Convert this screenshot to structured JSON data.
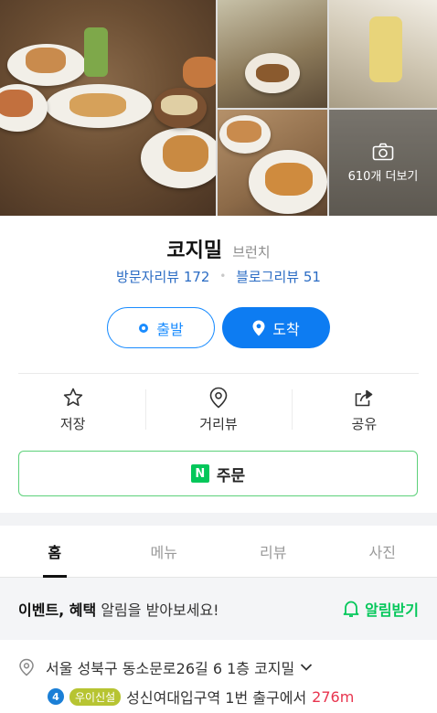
{
  "gallery": {
    "more_label": "610개 더보기",
    "camera_icon": "camera-icon"
  },
  "place": {
    "name": "코지밀",
    "category": "브런치",
    "visitor_review": "방문자리뷰 172",
    "blog_review": "블로그리뷰 51"
  },
  "route": {
    "depart_label": "출발",
    "arrive_label": "도착"
  },
  "actions": [
    {
      "label": "저장",
      "icon": "star-icon"
    },
    {
      "label": "거리뷰",
      "icon": "map-pin-outline-icon"
    },
    {
      "label": "공유",
      "icon": "share-icon"
    }
  ],
  "order": {
    "label": "주문",
    "logo": "N"
  },
  "tabs": [
    {
      "label": "홈",
      "active": true
    },
    {
      "label": "메뉴",
      "active": false
    },
    {
      "label": "리뷰",
      "active": false
    },
    {
      "label": "사진",
      "active": false
    }
  ],
  "event": {
    "bold_text": "이벤트, 혜택",
    "text": " 알림을 받아보세요!",
    "alarm_label": "알림받기"
  },
  "address": {
    "text": "서울 성북구 동소문로26길 6 1층 코지밀",
    "subway_line": "4",
    "line_tag": "우이신설",
    "station_text": "성신여대입구역 1번 출구에서",
    "distance": "276m"
  },
  "colors": {
    "brand_blue": "#0d7cf2",
    "naver_green": "#03c75a",
    "distance_red": "#e8344e"
  }
}
